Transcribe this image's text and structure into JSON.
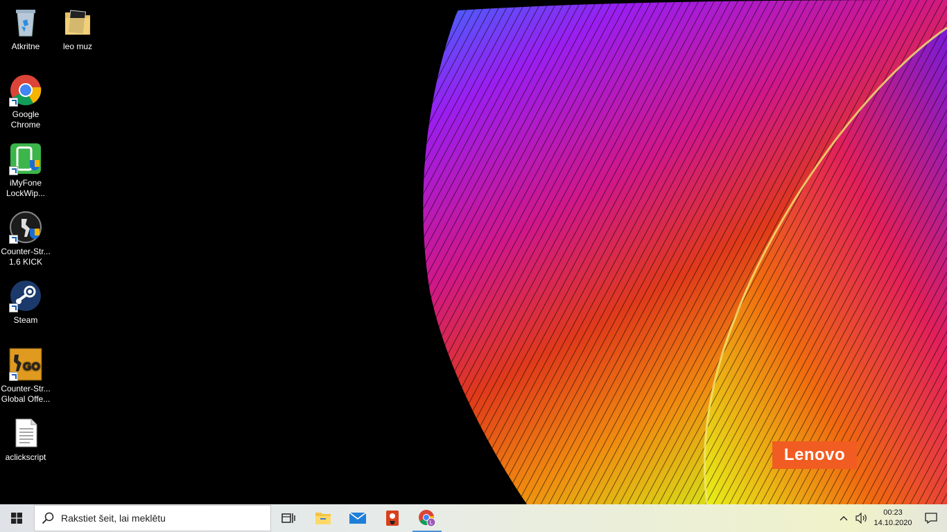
{
  "desktop": {
    "icons": [
      {
        "label": "Atkritne",
        "icon": "recycle-bin-icon"
      },
      {
        "label": "leo muz",
        "icon": "folder-icon"
      },
      {
        "label": "Google Chrome",
        "icon": "chrome-icon"
      },
      {
        "label": "iMyFone LockWip...",
        "icon": "imyfone-icon"
      },
      {
        "label": "Counter-Str... 1.6 KICK",
        "icon": "counter-strike-icon"
      },
      {
        "label": "Steam",
        "icon": "steam-icon"
      },
      {
        "label": "Counter-Str... Global Offe...",
        "icon": "csgo-icon"
      },
      {
        "label": "aclickscript",
        "icon": "text-file-icon"
      }
    ],
    "wallpaper_logo": "Lenovo"
  },
  "taskbar": {
    "search_placeholder": "Rakstiet šeit, lai meklētu",
    "pinned": [
      "task-view-icon",
      "file-explorer-icon",
      "mail-icon",
      "app-icon",
      "chrome-icon"
    ],
    "clock_time": "00:23",
    "clock_date": "14.10.2020",
    "accent": "#4a90d9"
  }
}
